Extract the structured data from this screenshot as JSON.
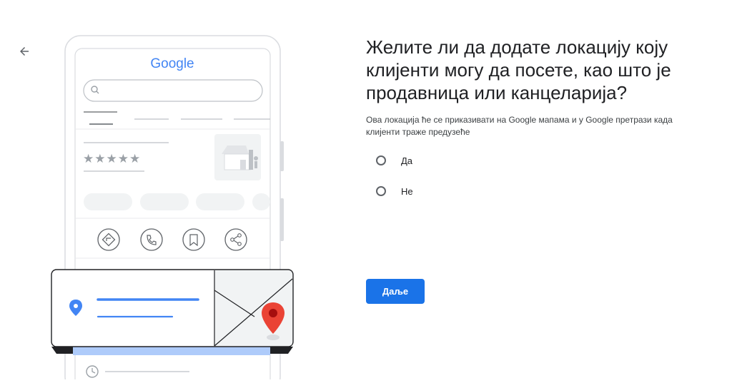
{
  "nav": {
    "back_icon": "arrow-left-icon"
  },
  "illustration": {
    "logo": "Google",
    "rating_stars": "★★★★★",
    "icons": [
      "directions-icon",
      "phone-icon",
      "bookmark-icon",
      "share-icon",
      "location-pin-icon",
      "map-pin-icon",
      "clock-icon",
      "search-icon",
      "storefront-icon"
    ],
    "colors": {
      "blue": "#4285F4",
      "red": "#EA4335",
      "yellow": "#FBBC05",
      "green": "#34A853",
      "accent": "#1a73e8"
    }
  },
  "question": {
    "title": "Желите ли да додате локацију коју клијенти могу да посете, као што је продавница или канцеларија?",
    "subtitle": "Ова локација ће се приказивати на Google мапама и у Google претрази када клијенти траже предузеће"
  },
  "options": [
    {
      "label": "Да",
      "selected": false
    },
    {
      "label": "Не",
      "selected": false
    }
  ],
  "actions": {
    "next_label": "Даље"
  }
}
